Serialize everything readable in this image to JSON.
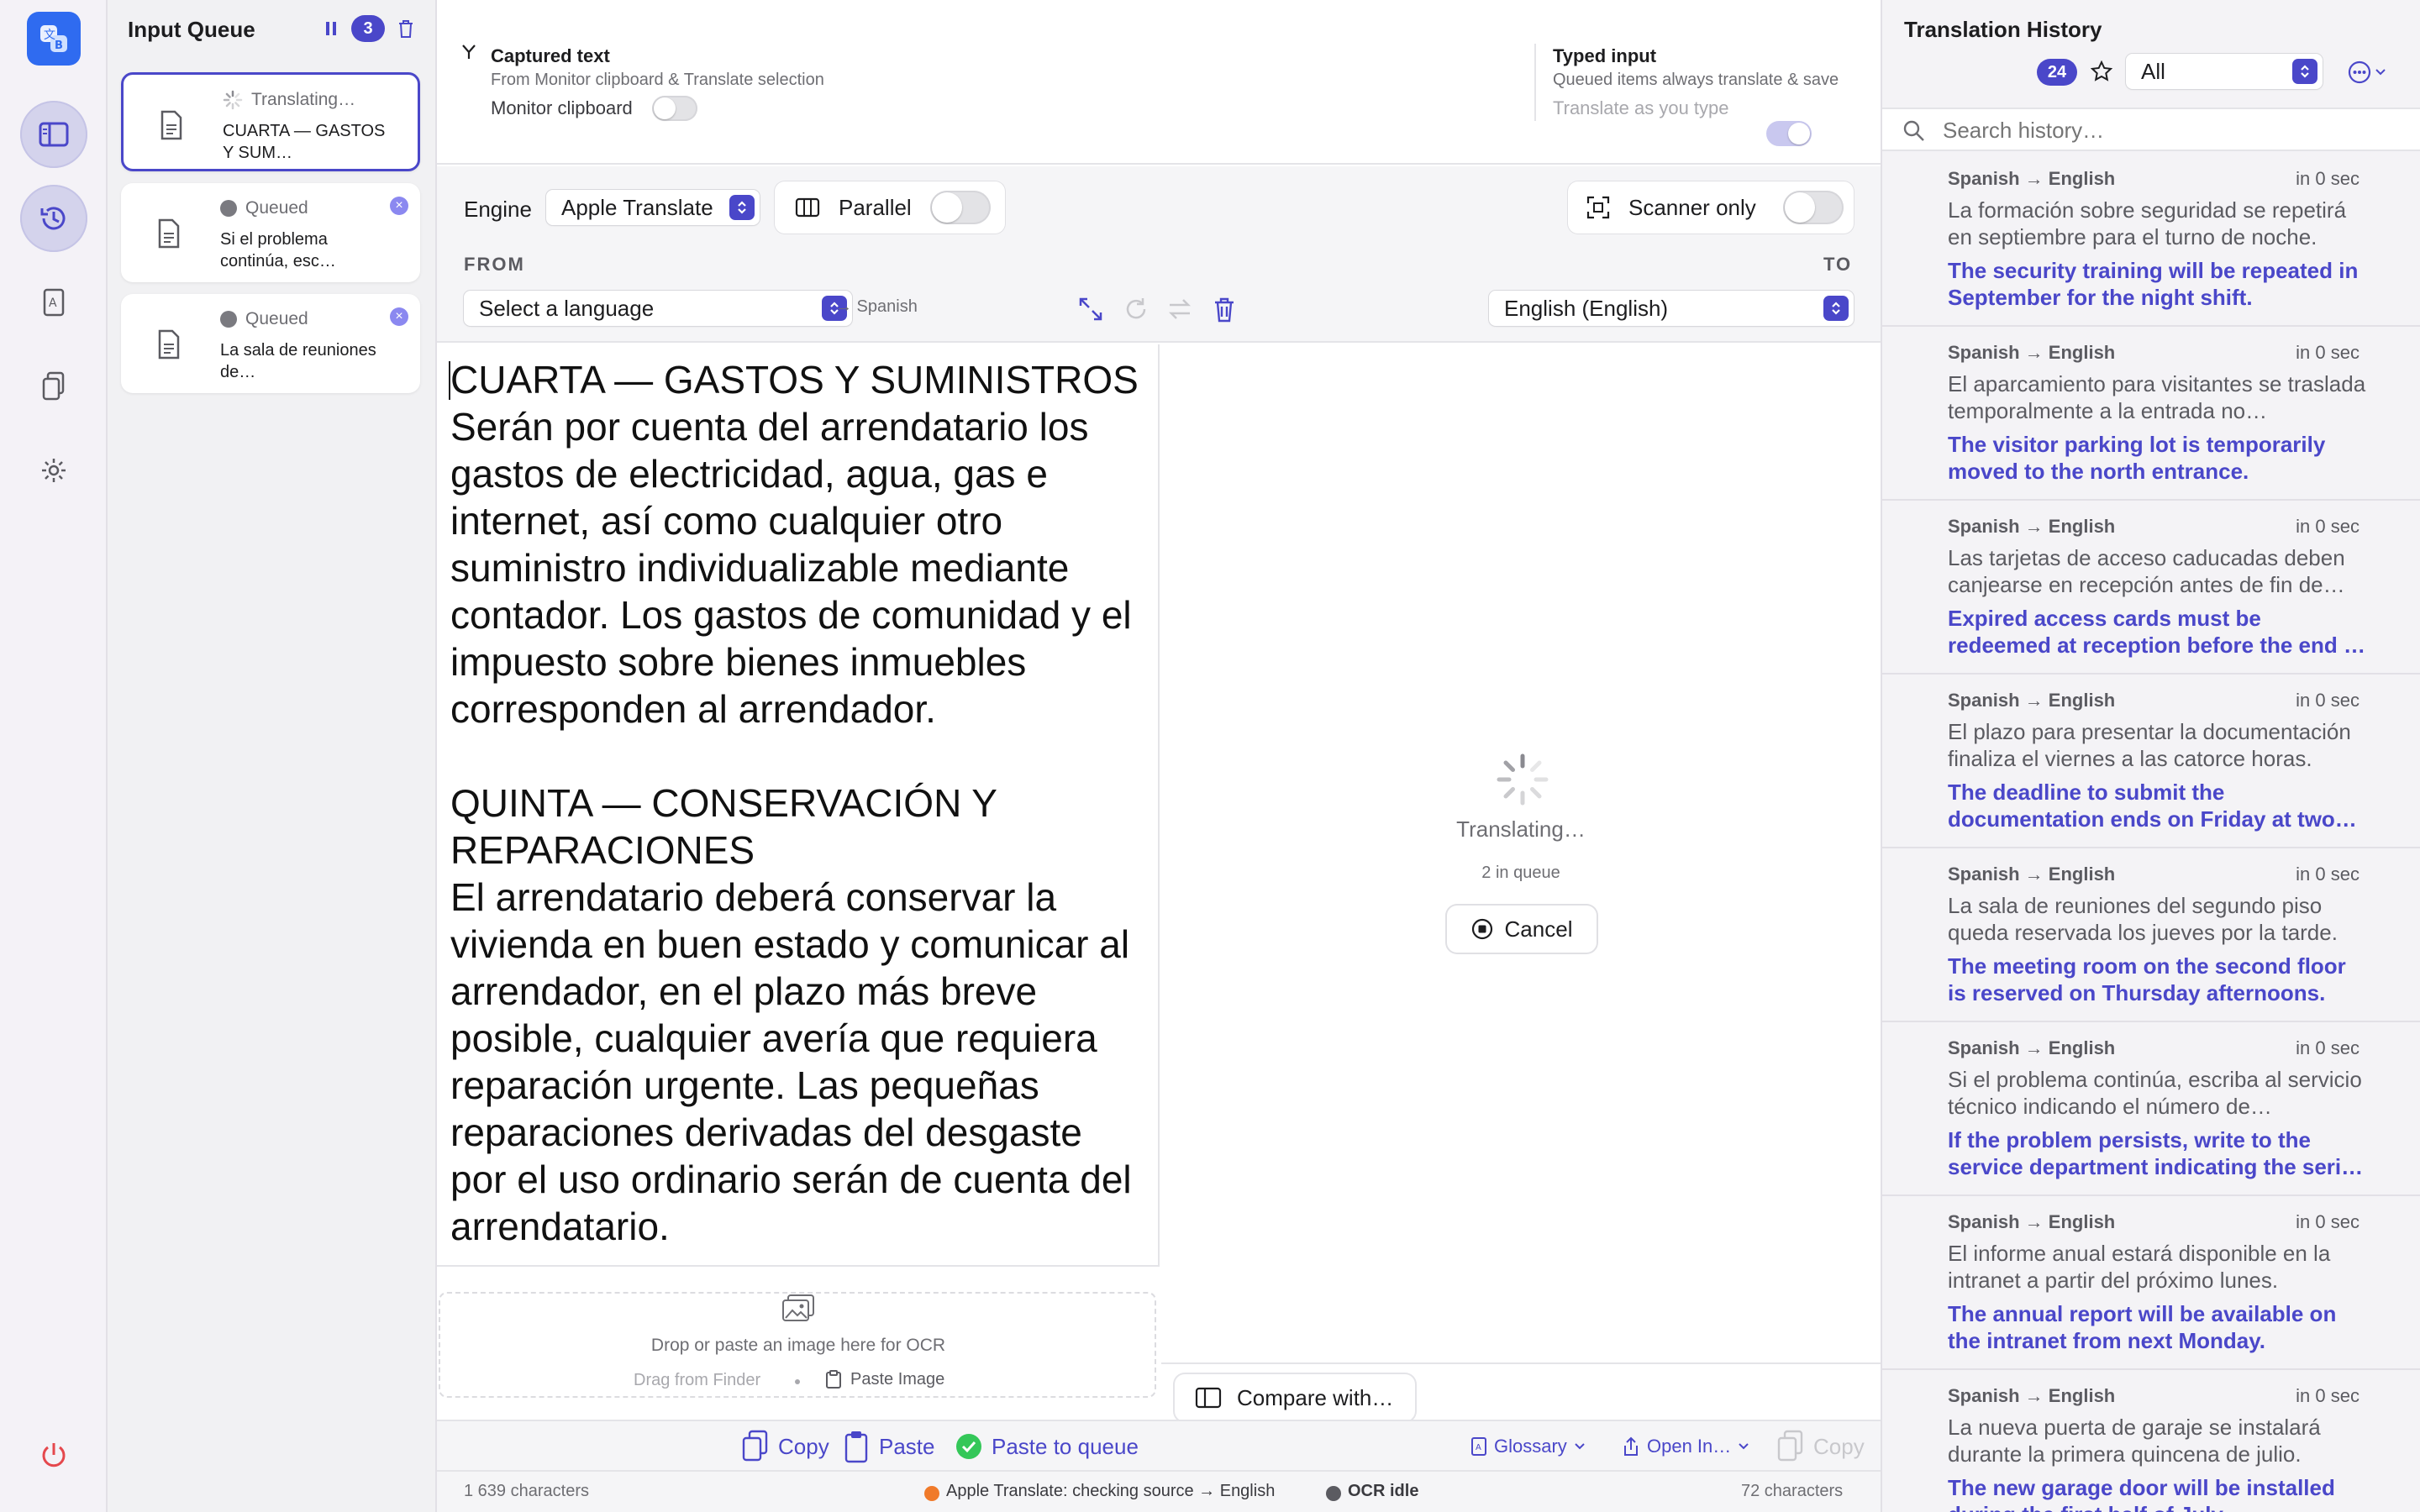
{
  "queue": {
    "title": "Input Queue",
    "count": "3",
    "items": [
      {
        "status": "Translating…",
        "snippet": "CUARTA — GASTOS Y SUM…"
      },
      {
        "status": "Queued",
        "snippet": "Si el problema continúa, esc…"
      },
      {
        "status": "Queued",
        "snippet": "La sala de reuniones de…"
      }
    ]
  },
  "capture": {
    "title": "Captured text",
    "subtitle": "From Monitor clipboard & Translate selection",
    "toggle_label": "Monitor clipboard"
  },
  "typed": {
    "title": "Typed input",
    "subtitle": "Queued items always translate & save",
    "toggle_label": "Translate as you type"
  },
  "controls": {
    "engine_label": "Engine",
    "engine_value": "Apple Translate",
    "parallel_label": "Parallel",
    "scanner_label": "Scanner only",
    "from_label": "FROM",
    "to_label": "TO",
    "from_value": "Select a language",
    "detected": "→ Spanish",
    "to_value": "English (English)"
  },
  "source": {
    "text": "CUARTA — GASTOS Y SUMINISTROS\nSerán por cuenta del arrendatario los gastos de electricidad, agua, gas e internet, así como cualquier otro suministro individualizable mediante contador. Los gastos de comunidad y el impuesto sobre bienes inmuebles corresponden al arrendador.\n\nQUINTA — CONSERVACIÓN Y REPARACIONES\nEl arrendatario deberá conservar la vivienda en buen estado y comunicar al arrendador, en el plazo más breve posible, cualquier avería que requiera reparación urgente. Las pequeñas reparaciones derivadas del desgaste por el uso ordinario serán de cuenta del arrendatario."
  },
  "ocr": {
    "hint": "Drop or paste an image here for OCR",
    "drag": "Drag from Finder",
    "paste": "Paste Image"
  },
  "target": {
    "status": "Translating…",
    "queue_info": "2 in queue",
    "cancel": "Cancel",
    "compare": "Compare with…"
  },
  "bottom": {
    "copy": "Copy",
    "paste": "Paste",
    "paste_queue": "Paste to queue",
    "glossary": "Glossary",
    "open_in": "Open In…",
    "copy_right": "Copy"
  },
  "status": {
    "chars_left": "1 639 characters",
    "engine_status": "Apple Translate: checking source → English",
    "ocr_status": "OCR idle",
    "chars_right": "72 characters"
  },
  "history": {
    "title": "Translation History",
    "count": "24",
    "filter": "All",
    "search_placeholder": "Search history…",
    "items": [
      {
        "pair": "Spanish → English",
        "time": "in 0 sec",
        "src": "La formación sobre seguridad se repetirá en septiembre para el turno de noche.",
        "dst": "The security training will be repeated in September for the night shift."
      },
      {
        "pair": "Spanish → English",
        "time": "in 0 sec",
        "src": "El aparcamiento para visitantes se traslada temporalmente a la entrada no…",
        "dst": "The visitor parking lot is temporarily moved to the north entrance."
      },
      {
        "pair": "Spanish → English",
        "time": "in 0 sec",
        "src": "Las tarjetas de acceso caducadas deben canjearse en recepción antes de fin de…",
        "dst": "Expired access cards must be redeemed at reception before the end of the mon…"
      },
      {
        "pair": "Spanish → English",
        "time": "in 0 sec",
        "src": "El plazo para presentar la documentación finaliza el viernes a las catorce horas.",
        "dst": "The deadline to submit the documentation ends on Friday at two…"
      },
      {
        "pair": "Spanish → English",
        "time": "in 0 sec",
        "src": "La sala de reuniones del segundo piso queda reservada los jueves por la tarde.",
        "dst": "The meeting room on the second floor is reserved on Thursday afternoons."
      },
      {
        "pair": "Spanish → English",
        "time": "in 0 sec",
        "src": "Si el problema continúa, escriba al servicio técnico indicando el número de…",
        "dst": "If the problem persists, write to the service department indicating the seri…"
      },
      {
        "pair": "Spanish → English",
        "time": "in 0 sec",
        "src": "El informe anual estará disponible en la intranet a partir del próximo lunes.",
        "dst": "The annual report will be available on the intranet from next Monday."
      },
      {
        "pair": "Spanish → English",
        "time": "in 0 sec",
        "src": "La nueva puerta de garaje se instalará durante la primera quincena de julio.",
        "dst": "The new garage door will be installed during the first half of July."
      }
    ]
  },
  "colors": {
    "accent": "#4a47c9",
    "status_dot": "#f07a2a"
  }
}
